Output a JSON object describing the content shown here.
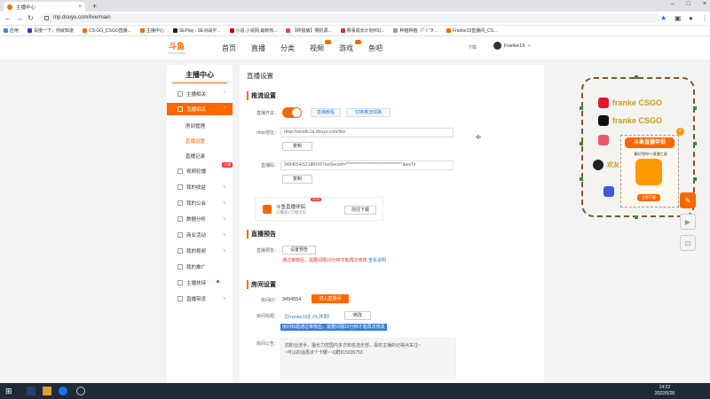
{
  "browser": {
    "tab_title": "主播中心",
    "url": "mp.douyu.com/live/main",
    "bookmarks": [
      "应用",
      "百度一下，你就知道",
      "CS:GO_CSGO直播...",
      "主播中心",
      "SEPlay - SE对战平...",
      "小说,小说网,最新热...",
      "【终极版】赛机源...",
      "赛事成长计划HS(...",
      "种植种植（「ゞ'ラ...",
      "Franke19直播间_CS..."
    ]
  },
  "site": {
    "logo": "斗鱼",
    "logo_sub": "DOUYU.COM",
    "nav": [
      "首页",
      "直播",
      "分类",
      "视频",
      "游戏",
      "鱼吧"
    ],
    "download": "下载",
    "username": "Franke19"
  },
  "sidebar": {
    "title": "主播中心",
    "items": [
      {
        "label": "主播相关"
      },
      {
        "label": "直播相关"
      },
      {
        "label": "视频轮播"
      },
      {
        "label": "我的收益"
      },
      {
        "label": "我的公会"
      },
      {
        "label": "数据分析"
      },
      {
        "label": "商业活动"
      },
      {
        "label": "我的视频"
      },
      {
        "label": "我的推广"
      },
      {
        "label": "主播扶持"
      },
      {
        "label": "直播带货"
      }
    ],
    "subitems": [
      "房间管理",
      "直播设置",
      "直播记录"
    ],
    "new_badge": "火爆"
  },
  "main": {
    "page_title": "直播设置",
    "stream": {
      "section": "推流设置",
      "switch_label": "直播开关：",
      "btn_tutorial": "直播教程",
      "btn_recommend": "切换推流线路",
      "rtmp_label": "rtmp地址：",
      "rtmp_value": "rtmp://sendtc1a.douyu.com/live",
      "copy1": "复制",
      "code_label": "直播码：",
      "code_value": "3494554r5218BIV67wsSecret=*********************************&wsTir",
      "copy2": "复制"
    },
    "promo": {
      "name": "斗鱼直播伴侣",
      "sub": "已覆盖1万播出码",
      "new": "NEW",
      "btn": "前往下载"
    },
    "preview": {
      "section": "直播预告",
      "label": "直播预告：",
      "btn": "设置预告",
      "note": "通过审核后，需要间隔10分钟才能再次修改",
      "link": "查看说明"
    },
    "room": {
      "section": "房间设置",
      "id_label": "房间ID：",
      "id_value": "3494554",
      "enter_btn": "进入直播间",
      "title_label": "房间标题：",
      "title_value": "【Franke19】PL冲刺!",
      "edit_btn": "修改",
      "title_note": "房间标题通过审核后，需要间隔10分钟才能再次修改",
      "announce_label": "房间公告：",
      "announce_lines": [
        "前职业选手，擅长力控国内多次知名选乐部，喜欢主播的记得点关注~",
        "~可以的话再点个卡鞭~~Q群915035753"
      ]
    }
  },
  "overlay": {
    "rows": [
      "franke CSGO",
      "franke CSGO",
      "",
      "欢友：回 0915035753"
    ],
    "helper_title": "斗鱼直播伴侣",
    "helper_sub": "最好用的PC直播工具",
    "helper_dl": "立即下载"
  },
  "taskbar": {
    "time": "14:22",
    "date": "2022/5/28"
  }
}
